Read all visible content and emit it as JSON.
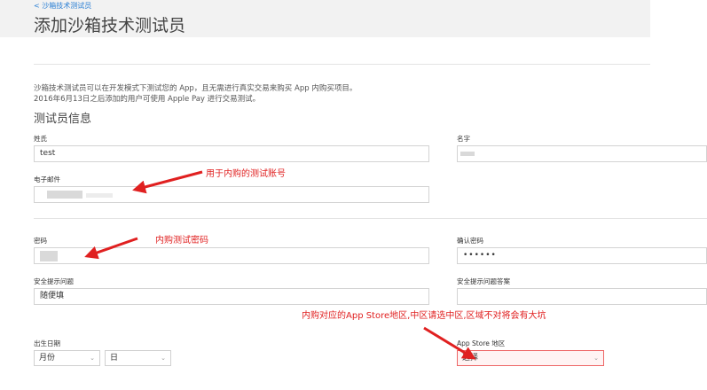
{
  "header": {
    "back_link": "< 沙箱技术测试员",
    "title": "添加沙箱技术测试员"
  },
  "intro": {
    "line1": "沙箱技术测试员可以在开发模式下测试您的 App，且无需进行真实交易来购买 App 内购买项目。",
    "line2": "2016年6月13日之后添加的用户可使用 Apple Pay 进行交易测试。"
  },
  "section_title": "测试员信息",
  "form": {
    "last_name_label": "姓氏",
    "last_name_value": "test",
    "first_name_label": "名字",
    "email_label": "电子邮件",
    "password_label": "密码",
    "confirm_password_label": "确认密码",
    "confirm_password_value": "••••••",
    "security_question_label": "安全提示问题",
    "security_question_value": "随便填",
    "security_answer_label": "安全提示问题答案",
    "birthdate_label": "出生日期",
    "month_value": "月份",
    "day_value": "日",
    "store_region_label": "App Store 地区",
    "store_region_value": "选择"
  },
  "annotations": {
    "email_note": "用于内购的测试账号",
    "password_note": "内购测试密码",
    "region_note": "内购对应的App Store地区,中区请选中区,区域不对将会有大坑"
  },
  "colors": {
    "annotation": "#e02020",
    "link": "#2a7fd4",
    "error_border": "#ee6666"
  },
  "icons": {
    "caret": "chevron-down-icon",
    "arrow": "red-arrow-icon"
  }
}
